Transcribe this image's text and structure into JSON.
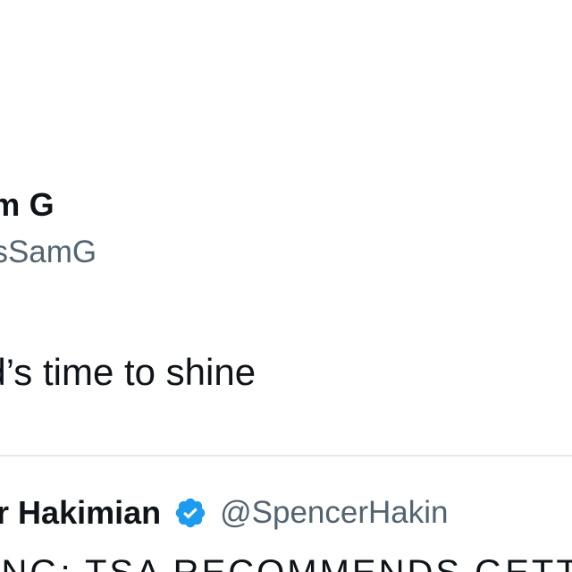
{
  "tweet": {
    "author_name": "am G",
    "author_handle": "ItsSamG",
    "text": "ad’s time to shine"
  },
  "quoted_tweet": {
    "author_name": "ncer Hakimian",
    "author_handle": "@SpencerHakin",
    "verified_icon": "verified-badge-icon",
    "text": "AKING: TSA RECOMMENDS GETTI"
  },
  "colors": {
    "text_primary": "#0f1419",
    "text_secondary": "#536471",
    "verified_blue": "#1d9bf0",
    "border": "#e6e9ec"
  }
}
